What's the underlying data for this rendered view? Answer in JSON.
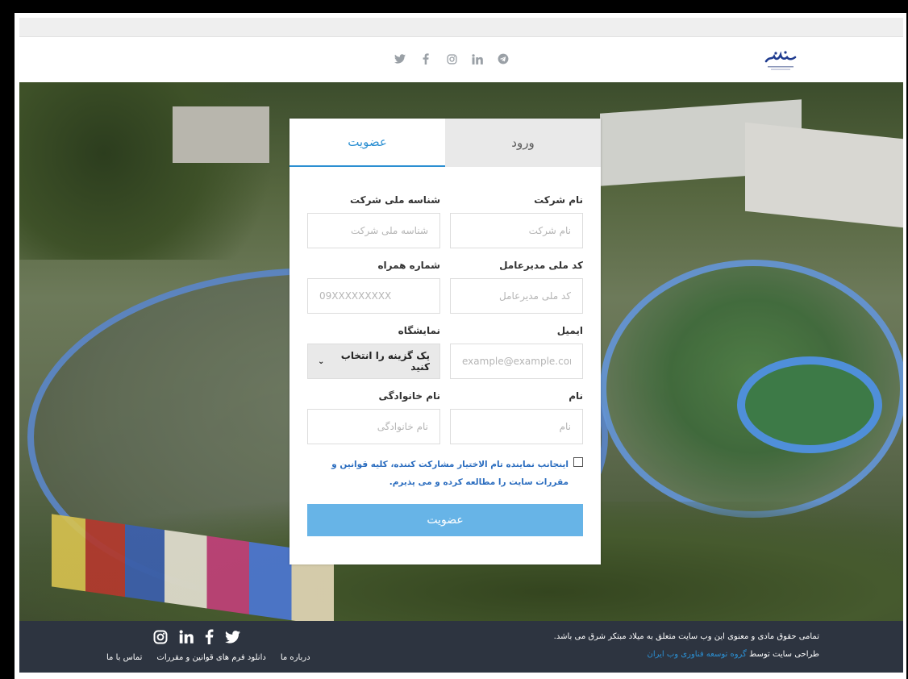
{
  "header": {
    "social_icons": [
      "twitter-icon",
      "facebook-icon",
      "instagram-icon",
      "linkedin-icon",
      "telegram-icon"
    ],
    "logo": "company-logo"
  },
  "tabs": {
    "login": "ورود",
    "register": "عضویت",
    "active": "register"
  },
  "form": {
    "company_name": {
      "label": "نام شرکت",
      "placeholder": "نام شرکت",
      "value": ""
    },
    "company_national_id": {
      "label": "شناسه ملی شرکت",
      "placeholder": "شناسه ملی شرکت",
      "value": ""
    },
    "ceo_national_code": {
      "label": "کد ملی مدیرعامل",
      "placeholder": "کد ملی مدیرعامل",
      "value": ""
    },
    "mobile": {
      "label": "شماره همراه",
      "placeholder": "09XXXXXXXXX",
      "value": ""
    },
    "email": {
      "label": "ایمیل",
      "placeholder": "example@example.com",
      "value": ""
    },
    "exhibition": {
      "label": "نمایشگاه",
      "selected": "یک گزینه را انتخاب کنید"
    },
    "first_name": {
      "label": "نام",
      "placeholder": "نام",
      "value": ""
    },
    "last_name": {
      "label": "نام خانوادگی",
      "placeholder": "نام خانوادگی",
      "value": ""
    },
    "terms_text": "اینجانب نماینده تام الاختیار مشارکت کننده، کلیه قوانین و مقررات سایت را مطالعه کرده و می پذیرم.",
    "terms_checked": false,
    "submit_label": "عضویت"
  },
  "footer": {
    "copyright": "تمامی حقوق مادی و معنوی این وب سایت متعلق به میلاد مبتکر شرق می باشد.",
    "credit_prefix": "طراحی سایت توسط",
    "credit_link": "گروه توسعه فناوری وب ایران",
    "links": [
      "درباره ما",
      "دانلود فرم های قوانین و مقررات",
      "تماس با ما"
    ],
    "social_icons": [
      "instagram-icon",
      "linkedin-icon",
      "facebook-icon",
      "twitter-icon"
    ]
  },
  "colors": {
    "accent": "#2b8fd2",
    "button": "#67b4e7",
    "footer_bg": "#2d3440"
  }
}
